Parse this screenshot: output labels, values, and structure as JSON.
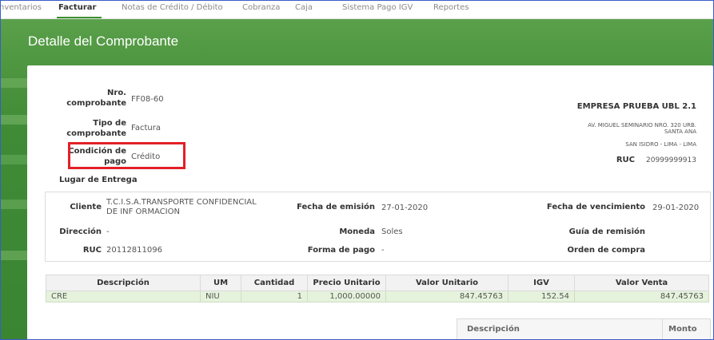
{
  "nav": {
    "tabs": [
      {
        "label": "nventarios"
      },
      {
        "label": "Facturar",
        "active": true
      },
      {
        "label": "Notas de Crédito / Débito"
      },
      {
        "label": "Cobranza"
      },
      {
        "label": "Caja"
      },
      {
        "label": "Sistema Pago IGV"
      },
      {
        "label": "Reportes"
      }
    ]
  },
  "page": {
    "title": "Detalle del Comprobante"
  },
  "header": {
    "nro_label": "Nro. comprobante",
    "nro_value": "FF08-60",
    "tipo_label": "Tipo de comprobante",
    "tipo_value": "Factura",
    "condicion_label": "Condición de pago",
    "condicion_value": "Crédito",
    "lugar_label": "Lugar de Entrega"
  },
  "company": {
    "name": "EMPRESA PRUEBA UBL 2.1",
    "address1": "AV. MIGUEL SEMINARIO NRO. 320 URB.",
    "address2": "SANTA ANA",
    "address3": "SAN ISIDRO - LIMA - LIMA",
    "ruc_label": "RUC",
    "ruc_value": "20999999913"
  },
  "client": {
    "cliente_label": "Cliente",
    "cliente_value_1": "T.C.I.S.A.TRANSPORTE CONFIDENCIAL",
    "cliente_value_2": "DE INF ORMACION",
    "direccion_label": "Dirección",
    "direccion_value": "-",
    "ruc_label": "RUC",
    "ruc_value": "20112811096",
    "fecha_emision_label": "Fecha de emisión",
    "fecha_emision_value": "27-01-2020",
    "moneda_label": "Moneda",
    "moneda_value": "Soles",
    "forma_pago_label": "Forma de pago",
    "forma_pago_value": "-",
    "fecha_venc_label": "Fecha de vencimiento",
    "fecha_venc_value": "29-01-2020",
    "guia_label": "Guía de remisión",
    "orden_label": "Orden de compra"
  },
  "items": {
    "headers": [
      "Descripción",
      "UM",
      "Cantidad",
      "Precio Unitario",
      "Valor Unitario",
      "IGV",
      "Valor Venta"
    ],
    "rows": [
      [
        "CRE",
        "NIU",
        "1",
        "1,000.00000",
        "847.45763",
        "152.54",
        "847.45763"
      ]
    ]
  },
  "summary": {
    "descripcion_label": "Descripción",
    "monto_label": "Monto"
  },
  "colors": {
    "accent": "#3c8f2f",
    "band": "#4f9640",
    "highlight": "#e32027",
    "row": "#e6f3dc"
  }
}
